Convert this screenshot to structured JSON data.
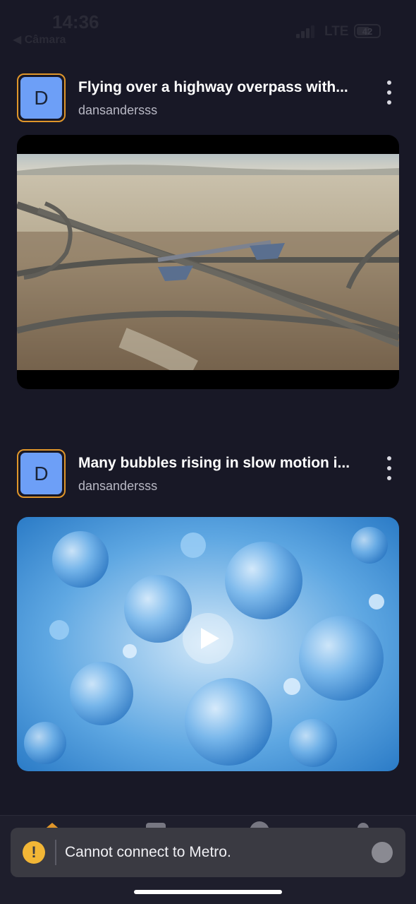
{
  "status": {
    "time": "14:36",
    "back_app": "◀ Câmara",
    "network": "LTE",
    "battery": "42"
  },
  "feed": [
    {
      "avatar_letter": "D",
      "title": "Flying over a highway overpass with...",
      "author": "dansandersss",
      "thumbnail": "aerial highway interchange"
    },
    {
      "avatar_letter": "D",
      "title": "Many bubbles rising in slow motion i...",
      "author": "dansandersss",
      "thumbnail": "blue bubbles underwater"
    }
  ],
  "toast": {
    "message": "Cannot connect to Metro.",
    "icon": "warning-icon"
  },
  "colors": {
    "background": "#181826",
    "avatar_border": "#e0962a",
    "avatar_fill": "#6d9ff7",
    "warning": "#f2b636"
  }
}
